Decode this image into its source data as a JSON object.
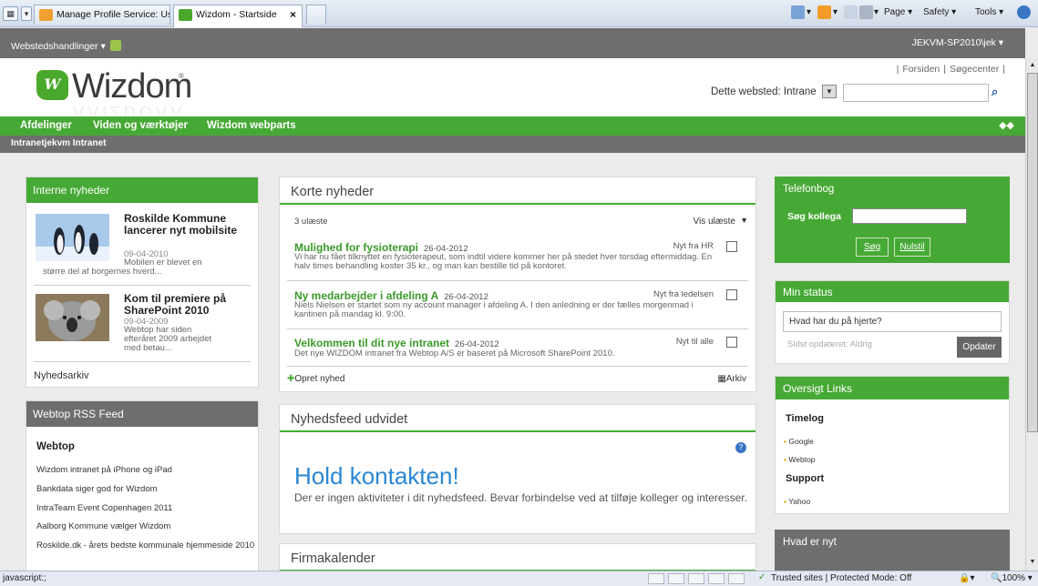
{
  "browser": {
    "tabs": [
      {
        "label": "Manage Profile Service: User..."
      },
      {
        "label": "Wizdom - Startside"
      }
    ],
    "commands": {
      "page": "Page ▾",
      "safety": "Safety ▾",
      "tools": "Tools ▾"
    },
    "status_text": "javascript:;",
    "security_zone": "Trusted sites | Protected Mode: Off",
    "zoom": "100%"
  },
  "ribbon": {
    "site_actions": "Webstedshandlinger ▾",
    "user": "JEKVM-SP2010\\jek ▾"
  },
  "header": {
    "logo": "Wizdom",
    "top_links": [
      "Forsiden",
      "Søgecenter"
    ],
    "search_scope": "Dette websted: Intrane"
  },
  "nav": {
    "items": [
      "Afdelinger",
      "Viden og værktøjer",
      "Wizdom webparts"
    ],
    "sub": "Intranetjekvm Intranet"
  },
  "interne_nyheder": {
    "title": "Interne nyheder",
    "items": [
      {
        "title": "Roskilde Kommune lancerer nyt mobilsite",
        "date": "09-04-2010",
        "excerpt_1": "Mobilen er blevet en",
        "excerpt_2": "større del af borgernes hverd..."
      },
      {
        "title": "Kom til premiere på SharePoint 2010",
        "date": "09-04-2009",
        "excerpt_1": "Webtop har siden",
        "excerpt_2": "efteråret 2009 arbejdet",
        "excerpt_3": "med betau..."
      }
    ],
    "archive": "Nyhedsarkiv"
  },
  "rss": {
    "title": "Webtop RSS Feed",
    "subtitle": "Webtop",
    "links": [
      "Wizdom intranet på iPhone og iPad",
      "Bankdata siger god for Wizdom",
      "IntraTeam Event Copenhagen 2011",
      "Aalborg Kommune vælger Wizdom",
      "Roskilde.dk - årets bedste kommunale hjemmeside 2010"
    ]
  },
  "korte_nyheder": {
    "title": "Korte nyheder",
    "unread": "3 ulæste",
    "show_read": "Vis ulæste",
    "items": [
      {
        "title": "Mulighed for fysioterapi",
        "date": "26-04-2012",
        "tag": "Nyt fra HR",
        "body": "Vi har nu fået tilknyttet en fysioterapeut, som indtil videre kommer her på stedet hver torsdag eftermiddag. En halv times behandling koster 35 kr., og man kan bestille tid på kontoret."
      },
      {
        "title": "Ny medarbejder i afdeling A",
        "date": "26-04-2012",
        "tag": "Nyt fra ledelsen",
        "body": "Niels Nielsen er startet som ny account manager i afdeling A. I den anledning er der fælles morgenmad i kantinen på mandag kl. 9:00."
      },
      {
        "title": "Velkommen til dit nye intranet",
        "date": "26-04-2012",
        "tag": "Nyt til alle",
        "body": "Det nye WIZDOM intranet fra Webtop A/S er baseret på Microsoft SharePoint 2010."
      }
    ],
    "create": "Opret nyhed",
    "archive": "Arkiv"
  },
  "nyhedsfeed": {
    "title": "Nyhedsfeed udvidet",
    "heading": "Hold kontakten!",
    "body": "Der er ingen aktiviteter i dit nyhedsfeed. Bevar forbindelse ved at tilføje kolleger og interesser."
  },
  "firmakalender": {
    "title": "Firmakalender"
  },
  "telefonbog": {
    "title": "Telefonbog",
    "label": "Søg kollega",
    "search_btn": "Søg",
    "reset_btn": "Nulstil"
  },
  "min_status": {
    "title": "Min status",
    "placeholder": "Hvad har du på hjerte?",
    "updated": "Sidst opdateret: Aldrig",
    "button": "Opdater"
  },
  "oversigt_links": {
    "title": "Oversigt Links",
    "groups": [
      {
        "name": "Timelog",
        "links": [
          "Google",
          "Webtop"
        ]
      },
      {
        "name": "Support",
        "links": [
          "Yahoo"
        ]
      }
    ]
  },
  "hvad_er_nyt": {
    "title": "Hvad er nyt"
  },
  "colors": {
    "brand_green": "#47a935",
    "ribbon_grey": "#6e6e6e",
    "link_blue": "#2b86d4"
  }
}
